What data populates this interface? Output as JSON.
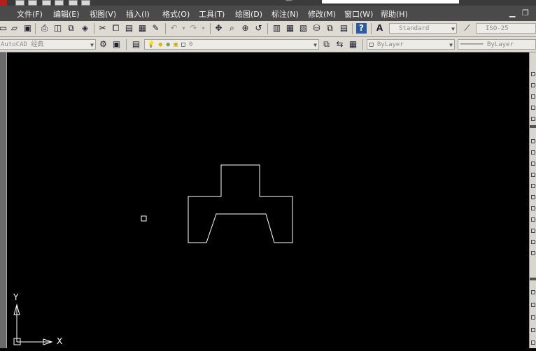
{
  "menu": {
    "file": "文件(F)",
    "edit": "编辑(E)",
    "view": "视图(V)",
    "insert": "插入(I)",
    "format": "格式(O)",
    "tools": "工具(T)",
    "draw": "绘图(D)",
    "dimension": "标注(N)",
    "modify": "修改(M)",
    "window": "窗口(W)",
    "help": "帮助(H)"
  },
  "toolbar": {
    "text_style": "Standard",
    "dim_style": "ISO-25"
  },
  "layers": {
    "workspace": "AutoCAD 经典",
    "current_layer": "0",
    "color": "ByLayer",
    "linetype": "ByLayer"
  },
  "ucs": {
    "x_label": "X",
    "y_label": "Y"
  },
  "colors": {
    "canvas": "#000000",
    "geometry": "#ffffff"
  }
}
